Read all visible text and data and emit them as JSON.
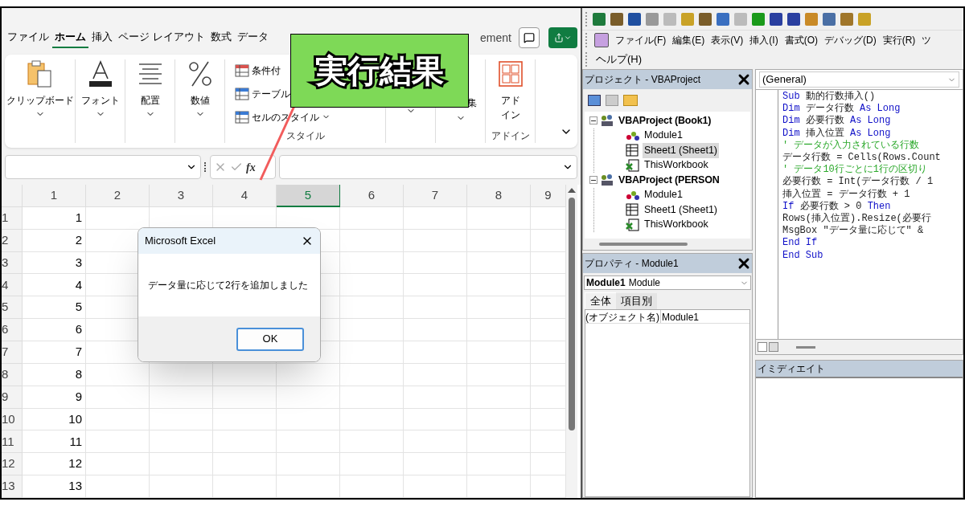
{
  "excel": {
    "tabs": [
      {
        "label": "ファイル",
        "selected": false
      },
      {
        "label": "ホーム",
        "selected": true
      },
      {
        "label": "挿入",
        "selected": false
      },
      {
        "label": "ページ レイアウト",
        "selected": false
      },
      {
        "label": "数式",
        "selected": false
      },
      {
        "label": "データ",
        "selected": false
      }
    ],
    "tab_fragment": "ement",
    "ribbon": {
      "groups": [
        {
          "kind": "large",
          "label": "クリップボード"
        },
        {
          "kind": "large",
          "label": "フォント"
        },
        {
          "kind": "large",
          "label": "配置"
        },
        {
          "kind": "large",
          "label": "数値"
        },
        {
          "kind": "styles",
          "items": [
            {
              "label": "条件付",
              "dropdown": false
            },
            {
              "label": "テーブル",
              "dropdown": false
            },
            {
              "label": "セルのスタイル",
              "dropdown": true
            }
          ],
          "group_label": "スタイル"
        },
        {
          "kind": "partial"
        },
        {
          "kind": "partial",
          "label": "集"
        },
        {
          "kind": "large",
          "label": "アドイン",
          "group_label": "アドイン"
        }
      ]
    },
    "formula_bar": {
      "fx_label": "fx"
    },
    "sheet": {
      "columns": [
        {
          "label": "1",
          "selected": false
        },
        {
          "label": "2",
          "selected": false
        },
        {
          "label": "3",
          "selected": false
        },
        {
          "label": "4",
          "selected": false
        },
        {
          "label": "5",
          "selected": true
        },
        {
          "label": "6",
          "selected": false
        },
        {
          "label": "7",
          "selected": false
        },
        {
          "label": "8",
          "selected": false
        },
        {
          "label": "9",
          "selected": false
        }
      ],
      "rows": [
        {
          "header": "1",
          "values": [
            "1"
          ]
        },
        {
          "header": "2",
          "values": [
            "2"
          ]
        },
        {
          "header": "3",
          "values": [
            "3"
          ]
        },
        {
          "header": "4",
          "values": [
            "4"
          ]
        },
        {
          "header": "5",
          "values": [
            "5"
          ]
        },
        {
          "header": "6",
          "values": [
            "6"
          ]
        },
        {
          "header": "7",
          "values": [
            "7"
          ]
        },
        {
          "header": "8",
          "values": [
            "8"
          ]
        },
        {
          "header": "9",
          "values": [
            "9"
          ]
        },
        {
          "header": "10",
          "values": [
            "10"
          ]
        },
        {
          "header": "11",
          "values": [
            "11"
          ]
        },
        {
          "header": "12",
          "values": [
            "12"
          ]
        },
        {
          "header": "13",
          "values": [
            "13"
          ]
        }
      ]
    },
    "dialog": {
      "title": "Microsoft Excel",
      "message": "データ量に応じて2行を追加しました",
      "button": "OK"
    }
  },
  "callout": {
    "text": "実行結果"
  },
  "vbe": {
    "menu": [
      "ファイル(F)",
      "編集(E)",
      "表示(V)",
      "挿入(I)",
      "書式(O)",
      "デバッグ(D)",
      "実行(R)",
      "ツ"
    ],
    "menu_row2": [
      "ヘルプ(H)"
    ],
    "project": {
      "title": "プロジェクト - VBAProject",
      "tree": [
        {
          "label": "VBAProject (Book1)",
          "kind": "project",
          "expanded": true,
          "selected": false,
          "children": [
            {
              "label": "Module1",
              "kind": "module",
              "selected": false
            },
            {
              "label": "Sheet1 (Sheet1)",
              "kind": "sheet",
              "selected": true
            },
            {
              "label": "ThisWorkbook",
              "kind": "workbook",
              "selected": false
            }
          ]
        },
        {
          "label": "VBAProject (PERSON",
          "kind": "project",
          "expanded": true,
          "selected": false,
          "children": [
            {
              "label": "Module1",
              "kind": "module",
              "selected": false
            },
            {
              "label": "Sheet1 (Sheet1)",
              "kind": "sheet",
              "selected": false
            },
            {
              "label": "ThisWorkbook",
              "kind": "workbook",
              "selected": false
            }
          ]
        }
      ]
    },
    "properties": {
      "title": "プロパティ - Module1",
      "object_name": "Module1",
      "object_type": "Module",
      "tabs": [
        {
          "label": "全体",
          "selected": true
        },
        {
          "label": "項目別",
          "selected": false
        }
      ],
      "rows": [
        {
          "name": "(オブジェクト名)",
          "value": "Module1"
        }
      ]
    },
    "code": {
      "object": "(General)",
      "lines": [
        [
          {
            "kind": "keyword",
            "text": "Sub"
          },
          {
            "kind": "plain",
            "text": " 動的行数挿入()"
          }
        ],
        [
          {
            "kind": "keyword",
            "text": "Dim"
          },
          {
            "kind": "plain",
            "text": " データ行数 "
          },
          {
            "kind": "keyword",
            "text": "As Long"
          }
        ],
        [
          {
            "kind": "keyword",
            "text": "Dim"
          },
          {
            "kind": "plain",
            "text": " 必要行数 "
          },
          {
            "kind": "keyword",
            "text": "As Long"
          }
        ],
        [
          {
            "kind": "keyword",
            "text": "Dim"
          },
          {
            "kind": "plain",
            "text": " 挿入位置 "
          },
          {
            "kind": "keyword",
            "text": "As Long"
          }
        ],
        [
          {
            "kind": "comment",
            "text": "' データが入力されている行数"
          }
        ],
        [
          {
            "kind": "plain",
            "text": "データ行数 = Cells(Rows.Count"
          }
        ],
        [
          {
            "kind": "comment",
            "text": "' データ10行ごとに1行の区切り"
          }
        ],
        [
          {
            "kind": "plain",
            "text": "必要行数 = Int(データ行数 / 1"
          }
        ],
        [
          {
            "kind": "plain",
            "text": "挿入位置 = データ行数 + 1"
          }
        ],
        [
          {
            "kind": "keyword",
            "text": "If"
          },
          {
            "kind": "plain",
            "text": " 必要行数 > 0 "
          },
          {
            "kind": "keyword",
            "text": "Then"
          }
        ],
        [
          {
            "kind": "plain",
            "text": "Rows(挿入位置).Resize(必要行"
          }
        ],
        [
          {
            "kind": "plain",
            "text": "MsgBox \"データ量に応じて\" &"
          }
        ],
        [
          {
            "kind": "keyword",
            "text": "End If"
          }
        ],
        [
          {
            "kind": "keyword",
            "text": "End Sub"
          }
        ]
      ]
    },
    "immediate": {
      "title": "イミディエイト"
    }
  }
}
